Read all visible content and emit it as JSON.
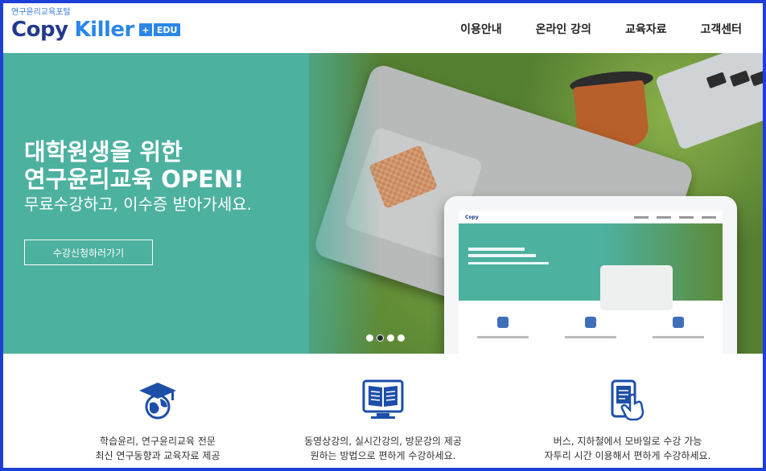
{
  "logo": {
    "sub": "연구윤리교육포털",
    "copy": "Copy",
    "killer": "Killer",
    "edu_mark": "+",
    "edu": "EDU"
  },
  "nav": {
    "items": [
      {
        "label": "이용안내"
      },
      {
        "label": "온라인 강의"
      },
      {
        "label": "교육자료"
      },
      {
        "label": "고객센터"
      }
    ]
  },
  "hero": {
    "title_line1": "대학원생을 위한",
    "title_line2": "연구윤리교육 OPEN!",
    "subtitle": "무료수강하고, 이수증 받아가세요.",
    "cta": "수강신청하러가기",
    "slides": {
      "count": 4,
      "active": 2
    }
  },
  "features": [
    {
      "icon": "graduation-globe-icon",
      "line1": "학습윤리, 연구윤리교육 전문",
      "line2": "최신 연구동향과 교육자료 제공"
    },
    {
      "icon": "open-book-monitor-icon",
      "line1": "동영상강의, 실시간강의, 방문강의 제공",
      "line2": "원하는 방법으로 편하게 수강하세요."
    },
    {
      "icon": "mobile-touch-icon",
      "line1": "버스, 지하철에서 모바일로 수강 가능",
      "line2": "자투리 시간 이용해서 편하게 수강하세요."
    }
  ],
  "colors": {
    "frame_border": "#1d3fd8",
    "hero_teal": "#4db19f",
    "brand_navy": "#233a8c",
    "brand_blue": "#2b87e6",
    "icon_blue": "#1e4fa8"
  }
}
